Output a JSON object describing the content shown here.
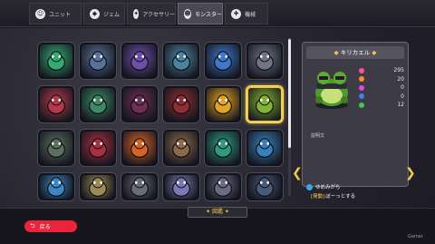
{
  "tabs": [
    {
      "icon": "person-icon",
      "glyph": "☺",
      "label": "ユニット",
      "active": false
    },
    {
      "icon": "gem-icon",
      "glyph": "◆",
      "label": "ジェム",
      "active": false
    },
    {
      "icon": "accessory-icon",
      "glyph": "✦",
      "label": "アクセサリー",
      "active": false
    },
    {
      "icon": "monster-icon",
      "glyph": "☻",
      "label": "モンスター",
      "active": true
    },
    {
      "icon": "machine-icon",
      "glyph": "✚",
      "label": "機械",
      "active": false
    }
  ],
  "grid": {
    "selected_index": 11,
    "monsters": [
      {
        "name": "green-bird",
        "bg": "#36a872"
      },
      {
        "name": "ghost-mouse",
        "bg": "#58739a"
      },
      {
        "name": "purple-cat",
        "bg": "#6d4fa8"
      },
      {
        "name": "crystal-golem",
        "bg": "#4e83a0"
      },
      {
        "name": "blue-penguin",
        "bg": "#3f78c9"
      },
      {
        "name": "rock-beast",
        "bg": "#6e7586"
      },
      {
        "name": "mushroom",
        "bg": "#b03a4a"
      },
      {
        "name": "green-skull",
        "bg": "#3f8a66"
      },
      {
        "name": "bat",
        "bg": "#6f2f56"
      },
      {
        "name": "red-knight",
        "bg": "#8f2f33"
      },
      {
        "name": "sun-spirit",
        "bg": "#e2a424"
      },
      {
        "name": "frog",
        "bg": "#86b233"
      },
      {
        "name": "hooded-mouse",
        "bg": "#5a6f5e"
      },
      {
        "name": "red-flower",
        "bg": "#a83040"
      },
      {
        "name": "fire-spirit",
        "bg": "#d56226"
      },
      {
        "name": "stone-golem",
        "bg": "#8a6a4a"
      },
      {
        "name": "green-gator",
        "bg": "#2f9a7e"
      },
      {
        "name": "ice-cube",
        "bg": "#3a7fb8"
      },
      {
        "name": "blue-dragon",
        "bg": "#3d86c4"
      },
      {
        "name": "white-knight",
        "bg": "#9a8a55"
      },
      {
        "name": "skull-mask",
        "bg": "#6a6a78"
      },
      {
        "name": "white-ghost",
        "bg": "#7a7ab0"
      },
      {
        "name": "grey-mouse",
        "bg": "#6b6b86"
      },
      {
        "name": "black-mouse",
        "bg": "#4a5a7a"
      }
    ]
  },
  "panel": {
    "title": "キリカエル",
    "stats": [
      {
        "icon": "heart-icon",
        "color": "#ff4fa0",
        "value": "295"
      },
      {
        "icon": "attack-icon",
        "color": "#ff8a2a",
        "value": "20"
      },
      {
        "icon": "magic-icon",
        "color": "#e04ad6",
        "value": "0"
      },
      {
        "icon": "defense-icon",
        "color": "#4a7de8",
        "value": "0"
      },
      {
        "icon": "speed-icon",
        "color": "#3fc84a",
        "value": "12"
      }
    ],
    "description_label": "説明文"
  },
  "skill": {
    "name": "ゆめみがち",
    "tag": "[発動]",
    "effect": "ぼーっとする"
  },
  "footer": {
    "back_label": "戻る",
    "center_label": "✦ 図鑑 ✦",
    "watermark": "Gamer"
  }
}
